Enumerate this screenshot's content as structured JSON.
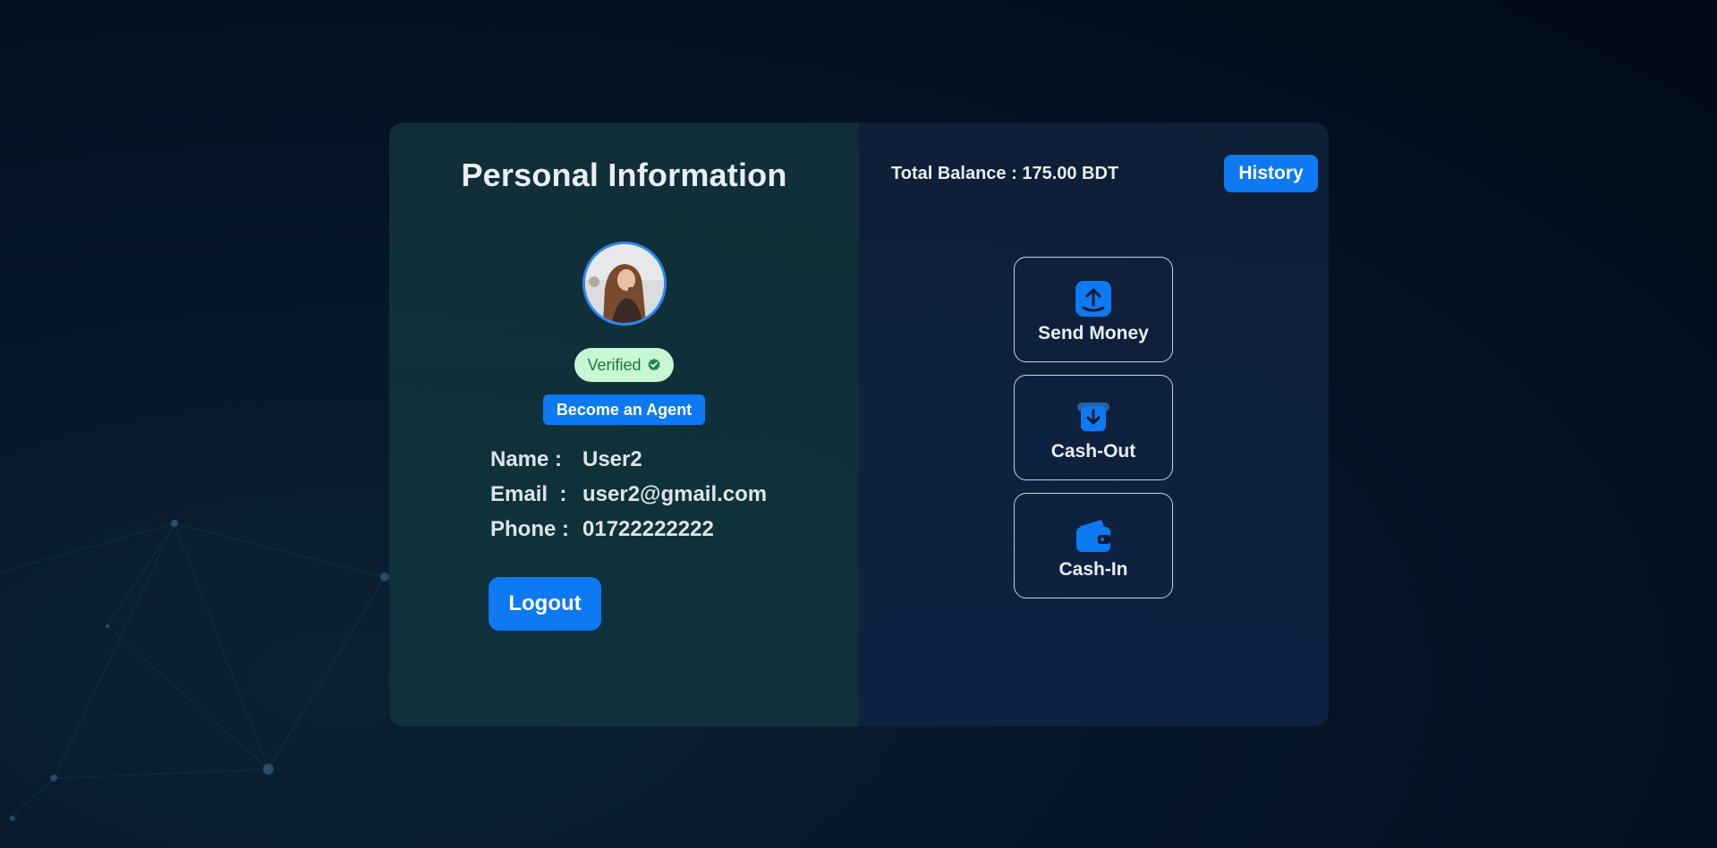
{
  "profile": {
    "title": "Personal Information",
    "verified_label": "Verified",
    "become_agent_label": "Become an Agent",
    "fields": [
      {
        "label": "Name :",
        "value": "User2"
      },
      {
        "label": "Email  :",
        "value": "user2@gmail.com"
      },
      {
        "label": "Phone :",
        "value": "01722222222"
      }
    ],
    "logout_label": "Logout"
  },
  "account": {
    "balance_text": "Total Balance : 175.00 BDT",
    "history_label": "History"
  },
  "actions": [
    {
      "label": "Send Money",
      "icon": "send-money-icon"
    },
    {
      "label": "Cash-Out",
      "icon": "cash-out-icon"
    },
    {
      "label": "Cash-In",
      "icon": "wallet-icon"
    }
  ],
  "colors": {
    "accent": "#0d79f2",
    "verified_bg": "#c8f7d6",
    "verified_text": "#177a3a"
  }
}
